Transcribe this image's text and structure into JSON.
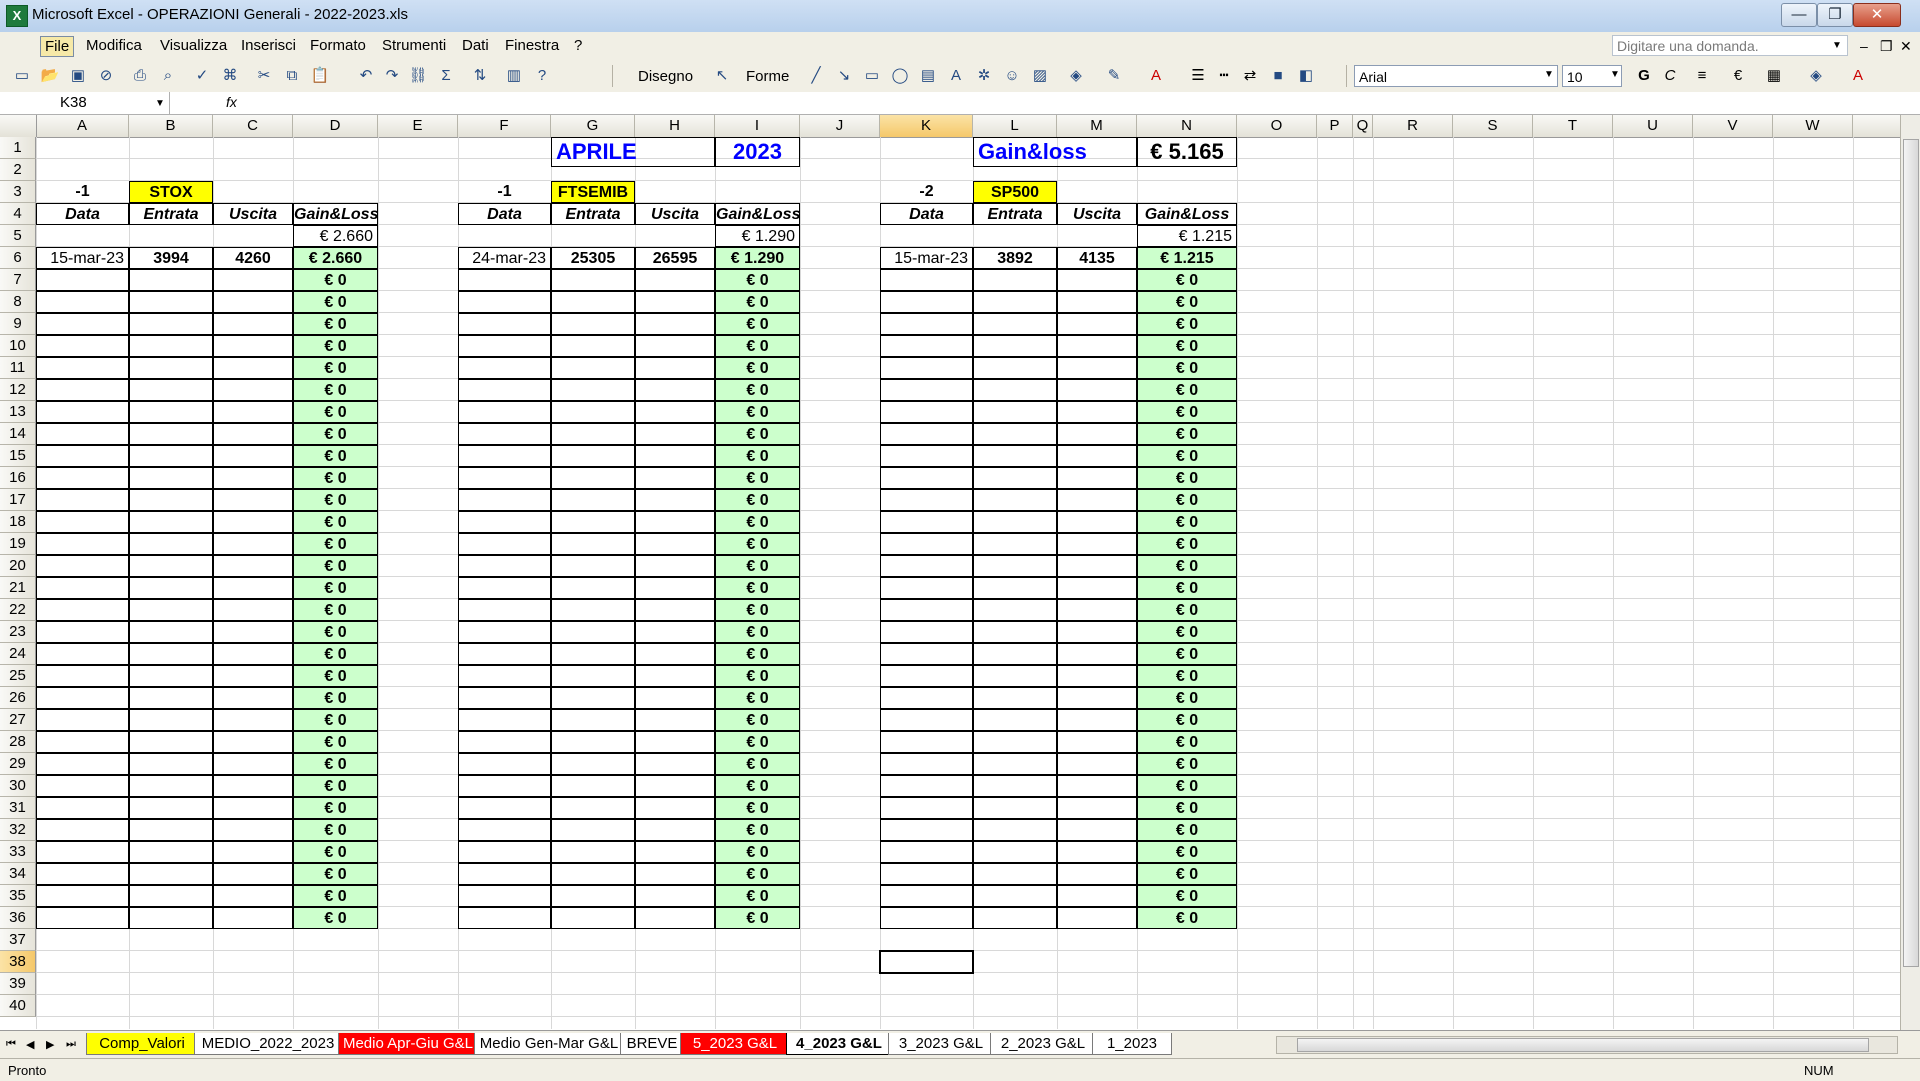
{
  "window": {
    "title": "Microsoft Excel - OPERAZIONI Generali - 2022-2023.xls",
    "minimize": "—",
    "maximize": "❐",
    "close": "✕"
  },
  "menu": {
    "items": [
      "File",
      "Modifica",
      "Visualizza",
      "Inserisci",
      "Formato",
      "Strumenti",
      "Dati",
      "Finestra",
      "?"
    ],
    "ask_placeholder": "Digitare una domanda."
  },
  "toolbar": {
    "draw_label": "Disegno",
    "shapes_label": "Forme",
    "font_name": "Arial",
    "font_size": "10",
    "bold": "G",
    "italic": "C"
  },
  "formula_bar": {
    "name_box": "K38",
    "fx": "fx",
    "value": ""
  },
  "columns": [
    "A",
    "B",
    "C",
    "D",
    "E",
    "F",
    "G",
    "H",
    "I",
    "J",
    "K",
    "L",
    "M",
    "N",
    "O",
    "P",
    "Q",
    "R",
    "S",
    "T",
    "U",
    "V",
    "W"
  ],
  "rows": [
    "1",
    "2",
    "3",
    "4",
    "5",
    "6",
    "7",
    "8",
    "9",
    "10",
    "11",
    "12",
    "13",
    "14",
    "15",
    "16",
    "17",
    "18",
    "19",
    "20",
    "21",
    "22",
    "23",
    "24",
    "25",
    "26",
    "27",
    "28",
    "29",
    "30",
    "31",
    "32",
    "33",
    "34",
    "35",
    "36",
    "37",
    "38",
    "39",
    "40"
  ],
  "header": {
    "month": "APRILE",
    "year": "2023",
    "gain_label": "Gain&loss",
    "gain_total": "€ 5.165"
  },
  "blocks": [
    {
      "multiplier": "-1",
      "index_name": "STOX",
      "col_labels": [
        "Data",
        "Entrata",
        "Uscita",
        "Gain&Loss"
      ],
      "subtotal": "€ 2.660",
      "trade": {
        "date": "15-mar-23",
        "entry": "3994",
        "exit": "4260",
        "gl": "€ 2.660"
      },
      "zero": "€ 0"
    },
    {
      "multiplier": "-1",
      "index_name": "FTSEMIB",
      "col_labels": [
        "Data",
        "Entrata",
        "Uscita",
        "Gain&Loss"
      ],
      "subtotal": "€ 1.290",
      "trade": {
        "date": "24-mar-23",
        "entry": "25305",
        "exit": "26595",
        "gl": "€ 1.290"
      },
      "zero": "€ 0"
    },
    {
      "multiplier": "-2",
      "index_name": "SP500",
      "col_labels": [
        "Data",
        "Entrata",
        "Uscita",
        "Gain&Loss"
      ],
      "subtotal": "€ 1.215",
      "trade": {
        "date": "15-mar-23",
        "entry": "3892",
        "exit": "4135",
        "gl": "€ 1.215"
      },
      "zero": "€ 0"
    }
  ],
  "sheets": [
    {
      "name": "Comp_Valori",
      "color": "#ffff00"
    },
    {
      "name": "MEDIO_2022_2023",
      "color": "#ffffff"
    },
    {
      "name": "Medio Apr-Giu G&L",
      "color": "#ff0000"
    },
    {
      "name": "Medio Gen-Mar G&L",
      "color": "#ffffff"
    },
    {
      "name": "BREVE",
      "color": "#ffffff"
    },
    {
      "name": "5_2023 G&L",
      "color": "#ff0000"
    },
    {
      "name": "4_2023 G&L",
      "color": "#ffffff"
    },
    {
      "name": "3_2023 G&L",
      "color": "#ffffff"
    },
    {
      "name": "2_2023 G&L",
      "color": "#ffffff"
    },
    {
      "name": "1_2023",
      "color": "#ffffff"
    }
  ],
  "active_sheet": "4_2023 G&L",
  "status": {
    "left": "Pronto",
    "num": "NUM"
  },
  "colors": {
    "highlight_yellow": "#ffff00",
    "gain_green": "#ccffcc",
    "title_blue": "#0000ff"
  }
}
